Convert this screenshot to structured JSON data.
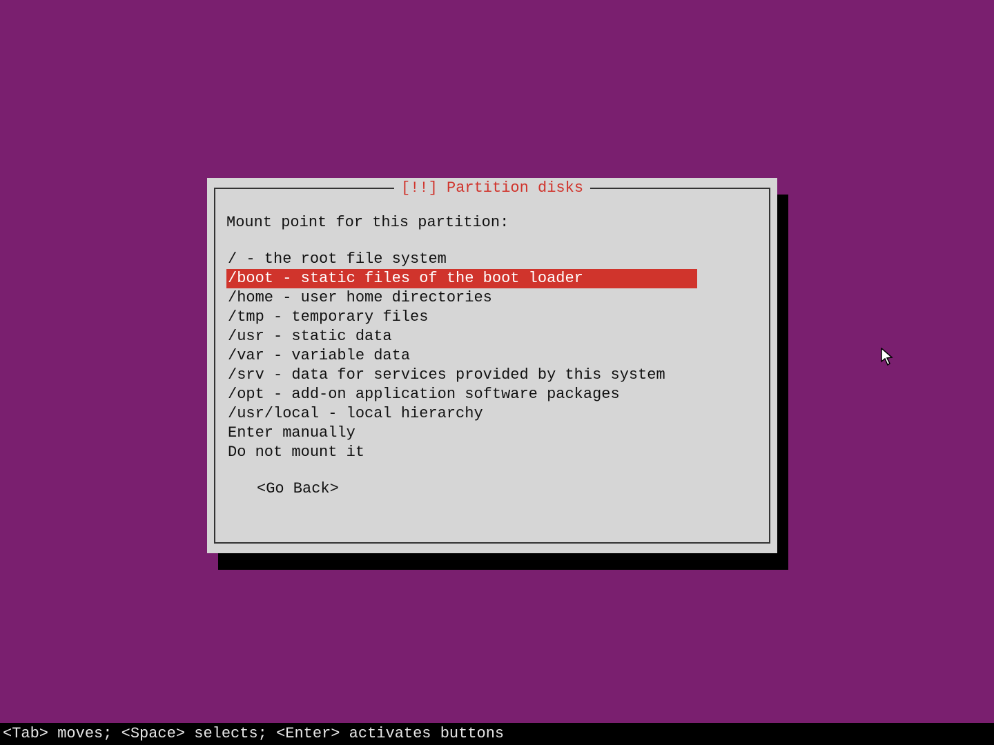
{
  "dialog": {
    "title": "[!!] Partition disks",
    "prompt": "Mount point for this partition:",
    "options": [
      {
        "label": "/ - the root file system",
        "selected": false
      },
      {
        "label": "/boot - static files of the boot loader",
        "selected": true
      },
      {
        "label": "/home - user home directories",
        "selected": false
      },
      {
        "label": "/tmp - temporary files",
        "selected": false
      },
      {
        "label": "/usr - static data",
        "selected": false
      },
      {
        "label": "/var - variable data",
        "selected": false
      },
      {
        "label": "/srv - data for services provided by this system",
        "selected": false
      },
      {
        "label": "/opt - add-on application software packages",
        "selected": false
      },
      {
        "label": "/usr/local - local hierarchy",
        "selected": false
      },
      {
        "label": "Enter manually",
        "selected": false
      },
      {
        "label": "Do not mount it",
        "selected": false
      }
    ],
    "go_back": "<Go Back>"
  },
  "status_bar": "<Tab> moves; <Space> selects; <Enter> activates buttons",
  "colors": {
    "background": "#7a1f6f",
    "dialog_bg": "#d6d6d6",
    "accent_red": "#d0342c",
    "text": "#111"
  }
}
